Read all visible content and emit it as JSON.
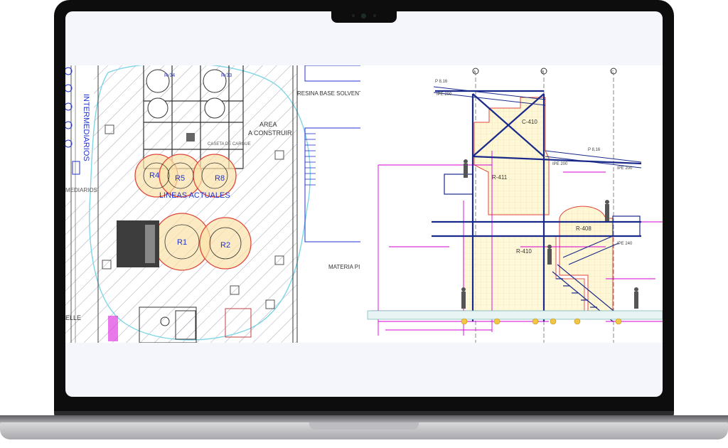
{
  "left_plan": {
    "labels": {
      "intermediarios": "INTERMEDIARIOS",
      "mediarios": "MEDIARIOS",
      "area_construir_1": "AREA",
      "area_construir_2": "A CONSTRUIR",
      "resina": "RESINA BASE SOLVENT",
      "lineas": "LINEAS ACTUALES",
      "materia": "MATERIA PI",
      "elle": "ELLE",
      "caseta": "CASETA DE CARGUE"
    },
    "reactors": [
      "R4",
      "R5",
      "R8",
      "R1",
      "R2"
    ],
    "tank_tags": [
      "R-34",
      "R-33"
    ]
  },
  "right_elevation": {
    "gridlines": [
      "A",
      "B",
      "C"
    ],
    "equipment": [
      "C-410",
      "R-411",
      "R-408",
      "R-410"
    ],
    "beams": [
      "IPE 200",
      "IPE 200",
      "IPE 200",
      "IPE 240"
    ],
    "levels": [
      "P 8,16",
      "P 8,16"
    ]
  },
  "colors": {
    "bezel": "#0d0d0d",
    "screen_bg": "#f4f6fb",
    "hatch": "#9aa0b0",
    "zone_circle": "#7fd6e6",
    "reactor_fill": "#fbe3a8",
    "reactor_stroke": "#e0463a",
    "label_blue": "#2233cc",
    "magenta": "#d400d4",
    "structure_blue": "#1a2a8a"
  }
}
